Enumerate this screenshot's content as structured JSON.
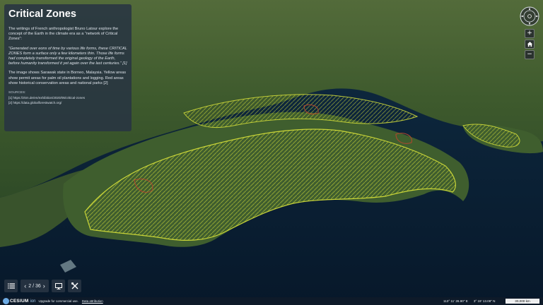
{
  "story": {
    "title": "Critical Zones",
    "p1": "The writings of French anthropologist Bruno Latour explore the concept of the Earth in the climate era as a “network of Critical Zones”:",
    "quote": "“Generated over eons of time by various life forms, these CRITICAL ZONES form a surface only a few kilometers thin. Those life forms had completely transformed the original geology of the Earth, before humanity transformed it yet again over the last centuries.” [1]",
    "p2": "The image shows Sarawak state in Borneo, Malaysia. Yellow areas show permit areas for palm oil plantations and logging. Red areas show historical conservation areas and national parks [2]",
    "sources_heading": "sources:",
    "sources": [
      "[1] https://zkm.de/en/exhibition/2020/05/critical-zones",
      "[2] https://data.globalforestwatch.org/"
    ]
  },
  "nav": {
    "zoom_in": "+",
    "home_icon": "home-icon",
    "zoom_out": "−",
    "compass_icon": "compass-icon"
  },
  "toolbar": {
    "list_icon": "list-icon",
    "prev_icon": "chevron-left-icon",
    "slide_counter": "2 / 36",
    "next_icon": "chevron-right-icon",
    "present_icon": "monitor-icon",
    "tools_icon": "tools-icon"
  },
  "footer": {
    "logo_text": "CESIUM",
    "logo_suffix": "ion",
    "upgrade_text": "Upgrade for commercial use.",
    "attribution_link": "Data attribution",
    "longitude": "113° 11' 26.90\" E",
    "latitude": "3° 19' 13.08\" N",
    "scale_label": "30,000 km"
  },
  "colors": {
    "panel_bg": "#283442",
    "permit_yellow": "#d8e23a",
    "conservation_red": "#b2462e",
    "ocean": "#0b2236",
    "forest": "#3d5a2c"
  }
}
